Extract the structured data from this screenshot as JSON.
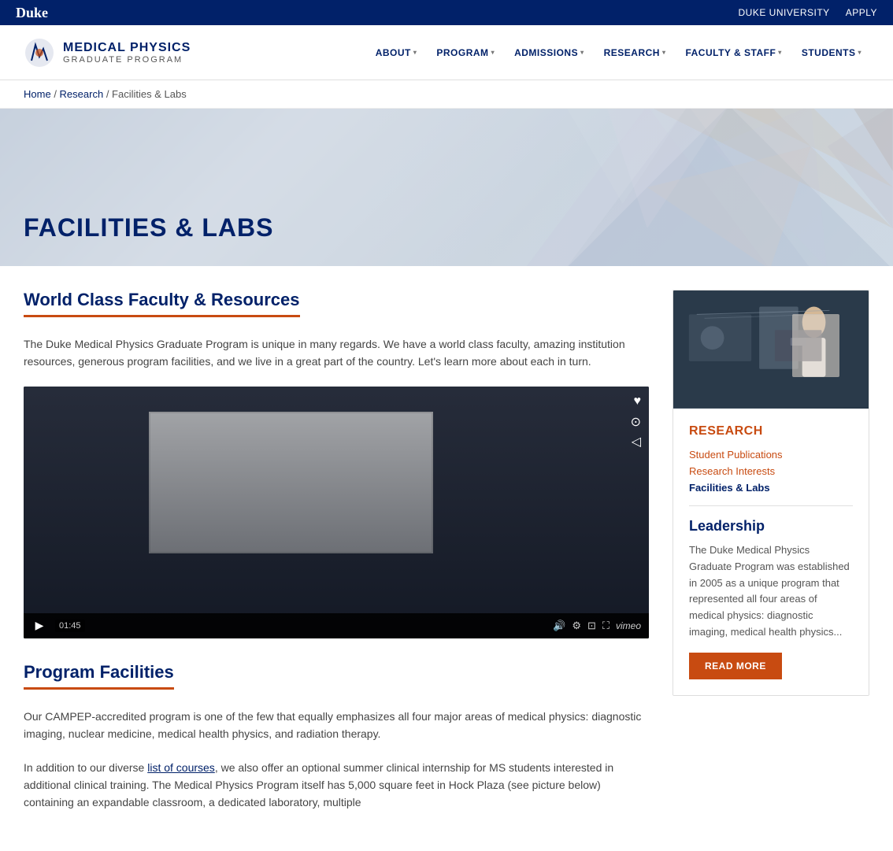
{
  "top_bar": {
    "duke_label": "Duke",
    "links": [
      {
        "label": "DUKE UNIVERSITY",
        "id": "duke-university-link"
      },
      {
        "label": "APPLY",
        "id": "apply-link"
      }
    ]
  },
  "site_logo": {
    "main_title": "MEDICAL PHYSICS",
    "sub_title": "GRADUATE PROGRAM"
  },
  "nav": {
    "items": [
      {
        "label": "ABOUT",
        "id": "about"
      },
      {
        "label": "PROGRAM",
        "id": "program"
      },
      {
        "label": "ADMISSIONS",
        "id": "admissions"
      },
      {
        "label": "RESEARCH",
        "id": "research"
      },
      {
        "label": "FACULTY & STAFF",
        "id": "faculty-staff"
      },
      {
        "label": "STUDENTS",
        "id": "students"
      }
    ]
  },
  "breadcrumb": {
    "home": "Home",
    "research": "Research",
    "current": "Facilities & Labs"
  },
  "hero": {
    "title": "FACILITIES & LABS"
  },
  "main_content": {
    "section1": {
      "title": "World Class Faculty & Resources",
      "body": "The Duke Medical Physics Graduate Program is unique in many regards. We have a world class faculty, amazing institution resources, generous program facilities, and we live in a great part of the country. Let's learn more about each in turn."
    },
    "video": {
      "timestamp": "01:45"
    },
    "section2": {
      "title": "Program Facilities",
      "para1": "Our CAMPEP-accredited program is one of the few that equally emphasizes all four major areas of medical physics: diagnostic imaging, nuclear medicine, medical health physics, and radiation therapy.",
      "para2_before_link": "In addition to our diverse ",
      "link_text": "list of courses",
      "para2_after_link": ", we also offer an optional summer clinical internship for MS students interested in additional clinical training. The Medical Physics Program itself has 5,000 square feet in Hock Plaza (see picture below) containing an expandable classroom, a dedicated laboratory, multiple"
    }
  },
  "sidebar": {
    "section_title": "RESEARCH",
    "links": [
      {
        "label": "Student Publications",
        "active": false,
        "id": "student-publications"
      },
      {
        "label": "Research Interests",
        "active": false,
        "id": "research-interests"
      },
      {
        "label": "Facilities & Labs",
        "active": true,
        "id": "facilities-labs"
      }
    ],
    "leadership": {
      "title": "Leadership",
      "text": "The Duke Medical Physics Graduate Program was established in 2005 as a unique program that represented all four areas of medical physics: diagnostic imaging, medical health physics...",
      "read_more_label": "READ MORE"
    }
  }
}
